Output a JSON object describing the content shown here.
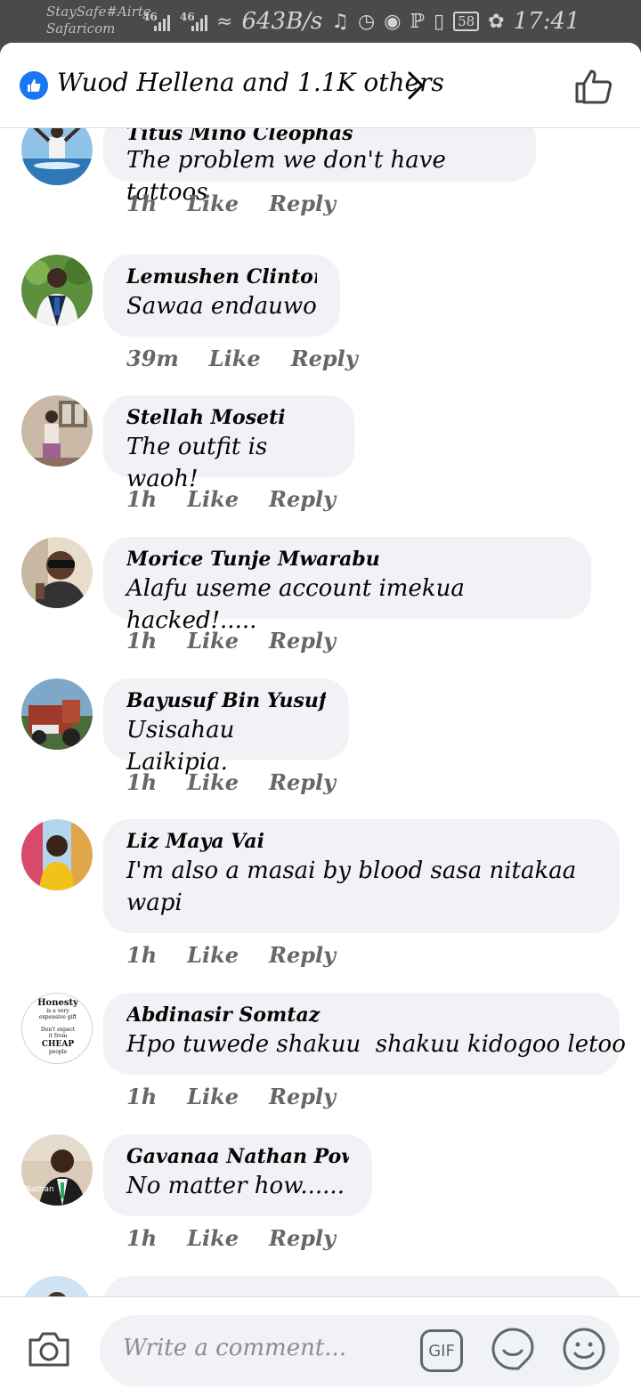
{
  "status_bar": {
    "carrier_line1": "StaySafe#Airte",
    "carrier_line2": "Safaricom",
    "sig1": "46",
    "sig2": "46",
    "speed": "643B/s",
    "battery": "58",
    "time": "17:41"
  },
  "header": {
    "likes_text": "Wuod Hellena and 1.1K others",
    "accent_color": "#1877f2"
  },
  "comments": [
    {
      "name": "Titus Mino Cleophas",
      "text": "The problem we don't have tattoos",
      "time": "1h",
      "like": "Like",
      "reply": "Reply"
    },
    {
      "name": "Lemushen Clinton",
      "text": "Sawaa endauwo",
      "time": "39m",
      "like": "Like",
      "reply": "Reply"
    },
    {
      "name": "Stellah Moseti",
      "text": "The outfit is waoh!",
      "time": "1h",
      "like": "Like",
      "reply": "Reply"
    },
    {
      "name": "Morice Tunje Mwarabu",
      "text": "Alafu useme account imekua hacked!.....",
      "time": "1h",
      "like": "Like",
      "reply": "Reply"
    },
    {
      "name": "Bayusuf Bin Yusuf",
      "text": "Usisahau Laikipia.",
      "time": "1h",
      "like": "Like",
      "reply": "Reply"
    },
    {
      "name": "Liz Maya Vai",
      "text": "I'm also a masai by blood sasa nitakaa wapi",
      "time": "1h",
      "like": "Like",
      "reply": "Reply"
    },
    {
      "name": "Abdinasir Somtaz",
      "text": "Hpo tuwede shakuu  shakuu kidogoo letoo",
      "time": "1h",
      "like": "Like",
      "reply": "Reply",
      "avatar_text": {
        "l1": "Honesty",
        "l2": "is a very",
        "l3": "expensive gift",
        "l4": "Don't expect",
        "l5": "it from",
        "l6": "CHEAP",
        "l7": "people"
      }
    },
    {
      "name": "Gavanaa Nathan Power",
      "text": "No matter how......",
      "time": "1h",
      "like": "Like",
      "reply": "Reply",
      "avatar_caption": "Nathan"
    }
  ],
  "composer": {
    "placeholder": "Write a comment...",
    "gif_label": "GIF"
  }
}
